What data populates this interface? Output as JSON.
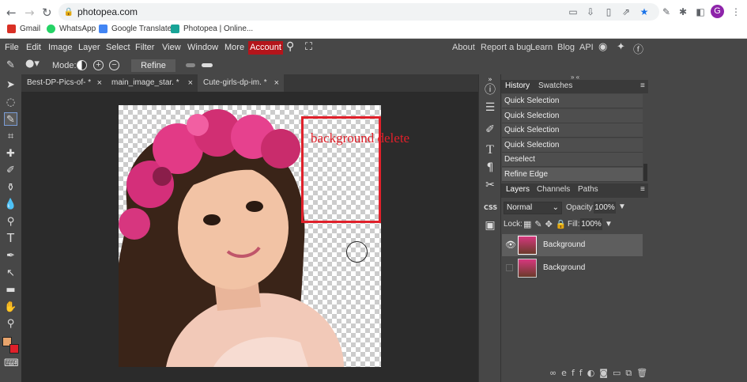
{
  "browser": {
    "url": "photopea.com",
    "avatar_letter": "G",
    "bookmarks": [
      {
        "label": "Gmail",
        "color": "#d93025"
      },
      {
        "label": "WhatsApp",
        "color": "#25d366"
      },
      {
        "label": "Google Translate",
        "color": "#4285f4"
      },
      {
        "label": "Photopea | Online...",
        "color": "#18a497"
      }
    ]
  },
  "menubar": {
    "items": [
      "File",
      "Edit",
      "Image",
      "Layer",
      "Select",
      "Filter",
      "View",
      "Window",
      "More"
    ],
    "account": "Account",
    "right": [
      "About",
      "Report a bug",
      "Learn",
      "Blog",
      "API"
    ]
  },
  "options": {
    "mode_label": "Mode:",
    "refine_edge": "Refine Edge"
  },
  "tabs": [
    {
      "label": "Best-DP-Pics-of-",
      "modified": "*",
      "close": "×"
    },
    {
      "label": "main_image_star.",
      "modified": "*",
      "close": "×"
    },
    {
      "label": "Cute-girls-dp-im.",
      "modified": "*",
      "close": "×"
    }
  ],
  "annotation": {
    "text": "background delete",
    "color": "#e0202a"
  },
  "history": {
    "tab_history": "History",
    "tab_swatches": "Swatches",
    "items": [
      "Quick Selection",
      "Quick Selection",
      "Quick Selection",
      "Quick Selection",
      "Deselect",
      "Refine Edge"
    ]
  },
  "layers": {
    "tab_layers": "Layers",
    "tab_channels": "Channels",
    "tab_paths": "Paths",
    "blend_mode": "Normal",
    "opacity_label": "Opacity:",
    "opacity": "100%",
    "lock_label": "Lock:",
    "fill_label": "Fill:",
    "fill": "100%",
    "items": [
      {
        "name": "Background",
        "visible": true,
        "selected": true
      },
      {
        "name": "Background",
        "visible": false,
        "selected": false
      }
    ]
  },
  "colors": {
    "foreground": "#e8a46c",
    "background": "#e0202a",
    "accent": "#b4151b"
  }
}
